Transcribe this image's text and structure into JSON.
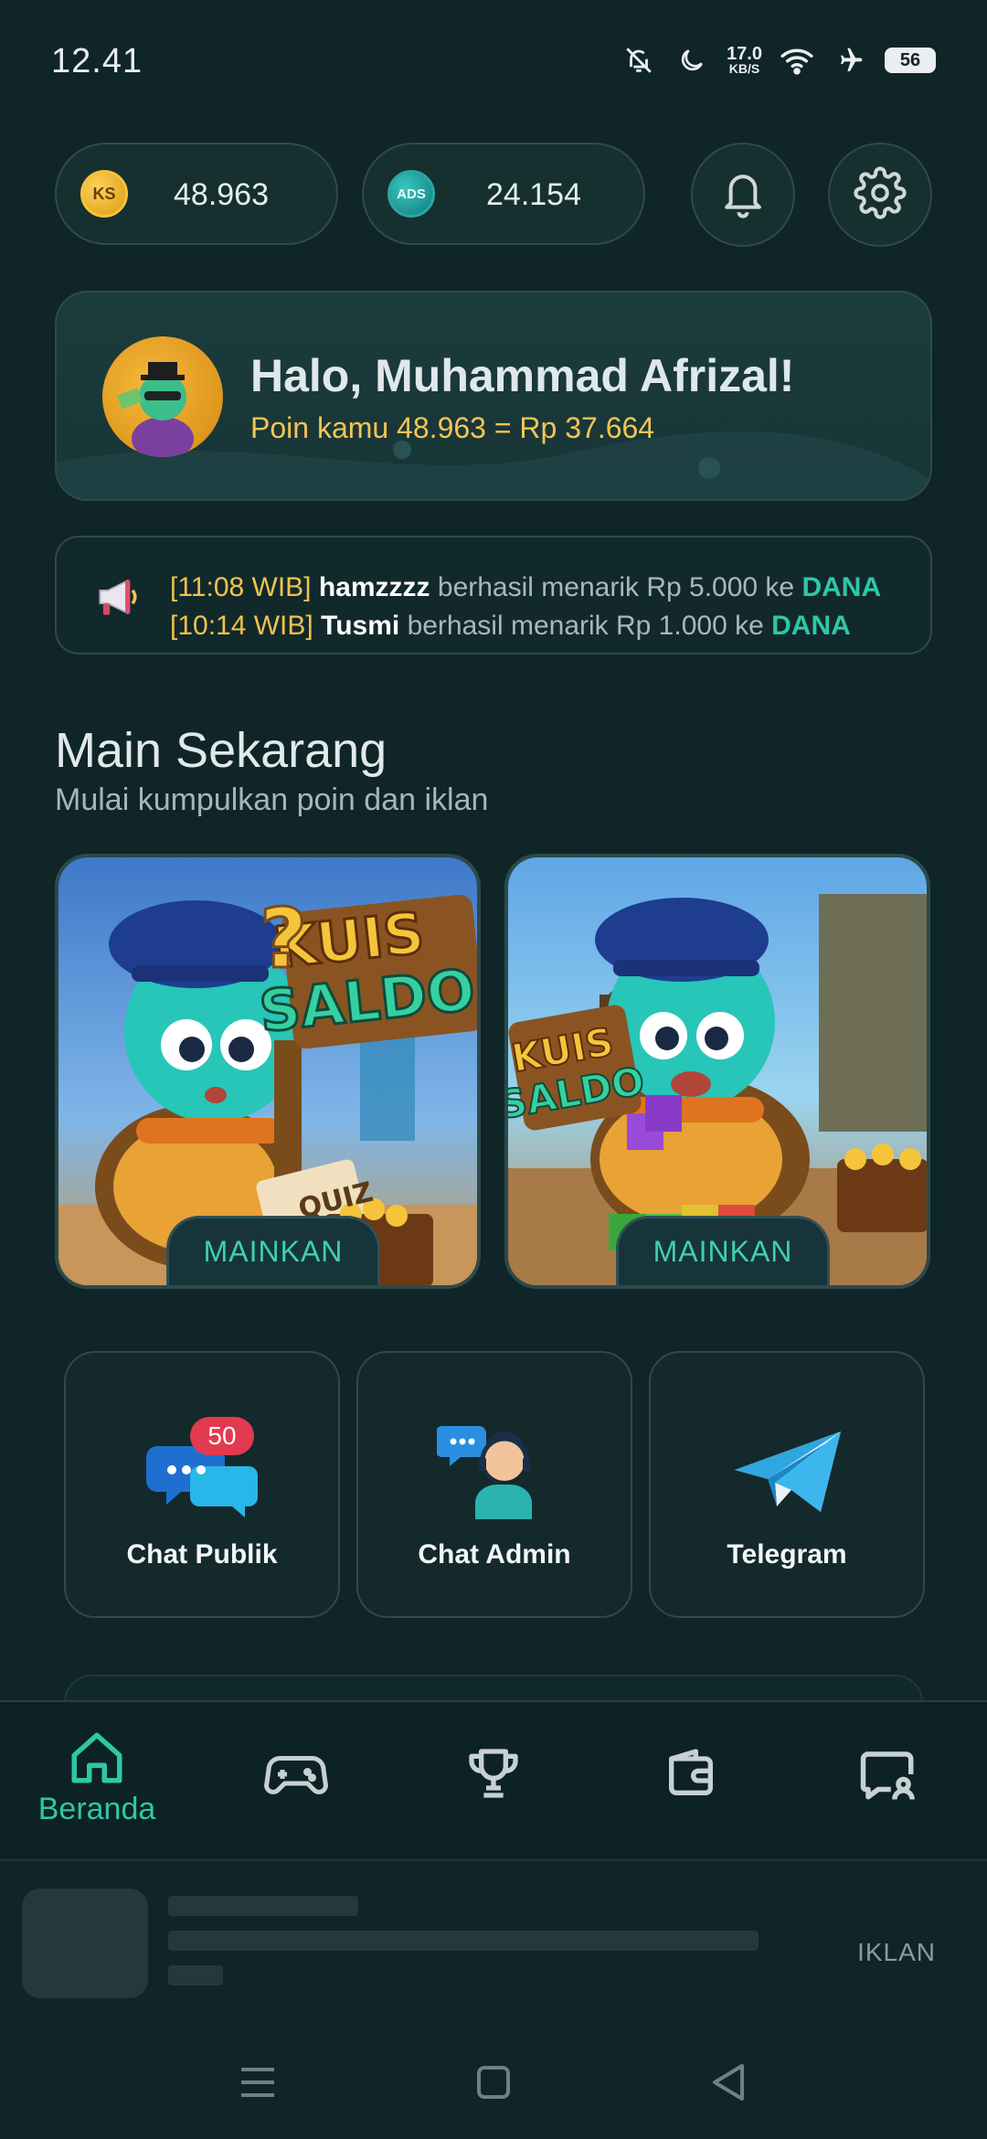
{
  "status_bar": {
    "time": "12.41",
    "speed_value": "17.0",
    "speed_unit": "KB/S",
    "battery": "56"
  },
  "balances": {
    "ks_label": "KS",
    "ks_value": "48.963",
    "ads_label": "ADS",
    "ads_value": "24.154"
  },
  "greeting": {
    "title": "Halo, Muhammad Afrizal!",
    "subtitle": "Poin kamu 48.963 = Rp 37.664"
  },
  "ticker": {
    "lines": [
      {
        "time": "[11:08 WIB]",
        "user": "hamzzzz",
        "message": "berhasil menarik Rp 5.000 ke",
        "dest": "DANA"
      },
      {
        "time": "[10:14 WIB]",
        "user": "Tusmi",
        "message": "berhasil menarik Rp 1.000 ke",
        "dest": "DANA"
      }
    ]
  },
  "section": {
    "title": "Main Sekarang",
    "subtitle": "Mulai kumpulkan poin dan iklan"
  },
  "games": [
    {
      "art_title_1": "KUIS",
      "art_title_2": "SALDO",
      "quiz_text": "QUIZ",
      "play_label": "MAINKAN"
    },
    {
      "art_title_1": "KUIS",
      "art_title_2": "SALDO",
      "play_label": "MAINKAN"
    }
  ],
  "quick_links": [
    {
      "label": "Chat Publik",
      "badge": "50",
      "icon": "chat-bubbles-icon"
    },
    {
      "label": "Chat Admin",
      "icon": "support-agent-icon"
    },
    {
      "label": "Telegram",
      "icon": "telegram-icon"
    }
  ],
  "bottom_nav": {
    "items": [
      {
        "label": "Beranda",
        "icon": "home-icon",
        "active": true
      },
      {
        "icon": "gamepad-icon"
      },
      {
        "icon": "trophy-icon"
      },
      {
        "icon": "wallet-icon"
      },
      {
        "icon": "chat-user-icon"
      }
    ]
  },
  "ad": {
    "tag": "IKLAN"
  },
  "colors": {
    "background": "#0f2528",
    "accent": "#2ec7a8",
    "gold": "#f6c453"
  }
}
